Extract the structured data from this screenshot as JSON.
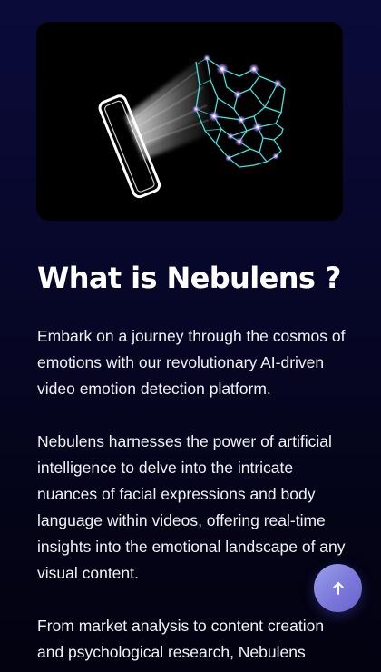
{
  "hero": {
    "icon": "face-scan-illustration"
  },
  "about": {
    "title": "What is Nebulens ?",
    "paragraphs": [
      "Embark on a journey through the cosmos of emotions with our revolutionary AI-driven video emotion detection platform.",
      "Nebulens harnesses the power of artificial intelligence to delve into the intricate nuances of facial expressions and body language within videos, offering real-time insights into the emotional landscape of any visual content.",
      "From market analysis to content creation and psychological research, Nebulens"
    ]
  },
  "scroll_top": {
    "icon": "arrow-up-icon"
  },
  "colors": {
    "background_top": "#0b0b3a",
    "background_bottom": "#020210",
    "accent": "#7b78da",
    "wireframe": "#3fe6e0"
  }
}
